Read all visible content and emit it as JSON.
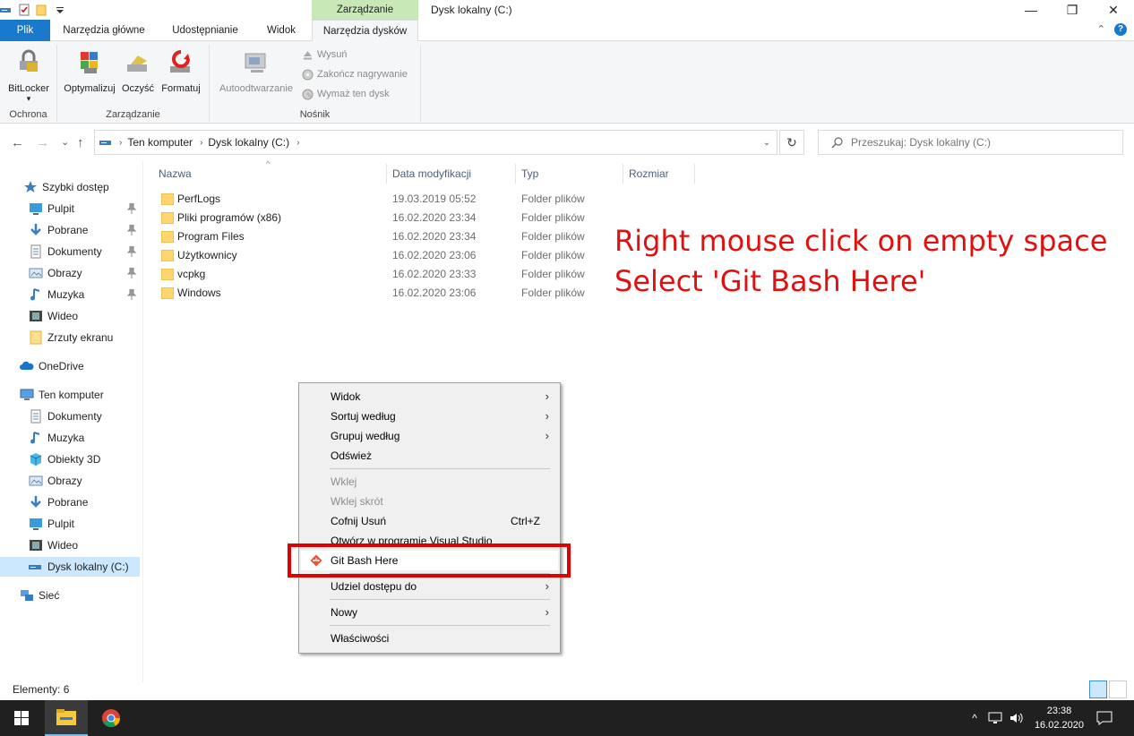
{
  "window": {
    "title": "Dysk lokalny (C:)",
    "context_tab_header": "Zarządzanie",
    "minimize_glyph": "—",
    "maximize_glyph": "❐",
    "close_glyph": "✕"
  },
  "ribbon": {
    "tabs": [
      "Plik",
      "Narzędzia główne",
      "Udostępnianie",
      "Widok",
      "Narzędzia dysków"
    ],
    "collapse_glyph": "⌃",
    "help_glyph": "?",
    "groups": {
      "ochrona": {
        "label": "Ochrona",
        "bitlocker": "BitLocker",
        "bitlocker_arrow": "▾"
      },
      "zarzadzanie": {
        "label": "Zarządzanie",
        "optimize": "Optymalizuj",
        "clean": "Oczyść",
        "format": "Formatuj"
      },
      "nosnik": {
        "label": "Nośnik",
        "autoplay": "Autoodtwarzanie",
        "eject": "Wysuń",
        "finish_burn": "Zakończ nagrywanie",
        "erase": "Wymaż ten dysk"
      }
    }
  },
  "nav": {
    "back": "←",
    "forward": "→",
    "recent": "⌄",
    "up": "↑",
    "breadcrumb": [
      "Ten komputer",
      "Dysk lokalny (C:)"
    ],
    "breadcrumb_sep": "›",
    "dropdown_glyph": "⌄",
    "refresh_glyph": "↻",
    "search_placeholder": "Przeszukaj: Dysk lokalny (C:)"
  },
  "sidebar": {
    "quick_access": "Szybki dostęp",
    "quick_items": [
      "Pulpit",
      "Pobrane",
      "Dokumenty",
      "Obrazy",
      "Muzyka",
      "Wideo",
      "Zrzuty ekranu"
    ],
    "onedrive": "OneDrive",
    "this_pc": "Ten komputer",
    "pc_items": [
      "Dokumenty",
      "Muzyka",
      "Obiekty 3D",
      "Obrazy",
      "Pobrane",
      "Pulpit",
      "Wideo",
      "Dysk lokalny (C:)"
    ],
    "network": "Sieć"
  },
  "filelist": {
    "columns": [
      "Nazwa",
      "Data modyfikacji",
      "Typ",
      "Rozmiar"
    ],
    "sort_glyph": "^",
    "rows": [
      {
        "name": "PerfLogs",
        "date": "19.03.2019 05:52",
        "type": "Folder plików"
      },
      {
        "name": "Pliki programów (x86)",
        "date": "16.02.2020 23:34",
        "type": "Folder plików"
      },
      {
        "name": "Program Files",
        "date": "16.02.2020 23:34",
        "type": "Folder plików"
      },
      {
        "name": "Użytkownicy",
        "date": "16.02.2020 23:06",
        "type": "Folder plików"
      },
      {
        "name": "vcpkg",
        "date": "16.02.2020 23:33",
        "type": "Folder plików"
      },
      {
        "name": "Windows",
        "date": "16.02.2020 23:06",
        "type": "Folder plików"
      }
    ]
  },
  "annotation": {
    "line1": "Right mouse click on empty space",
    "line2": "Select 'Git Bash Here'",
    "color": "#e01010"
  },
  "context_menu": {
    "submenu_arrow": "›",
    "items": {
      "view": "Widok",
      "sort": "Sortuj według",
      "group": "Grupuj według",
      "refresh": "Odśwież",
      "paste": "Wklej",
      "paste_shortcut": "Wklej skrót",
      "undo": "Cofnij Usuń",
      "undo_key": "Ctrl+Z",
      "open_vs": "Otwórz w programie Visual Studio",
      "git_bash": "Git Bash Here",
      "share": "Udziel dostępu do",
      "new": "Nowy",
      "properties": "Właściwości"
    }
  },
  "status": {
    "items": "Elementy: 6"
  },
  "taskbar": {
    "time": "23:38",
    "date": "16.02.2020",
    "tray_up": "^"
  },
  "colors": {
    "file_tab": "#1979ca",
    "context_tab": "#c8e8b8",
    "highlight_box": "#e00000",
    "selection": "#cce8ff",
    "taskbar": "#202020"
  }
}
